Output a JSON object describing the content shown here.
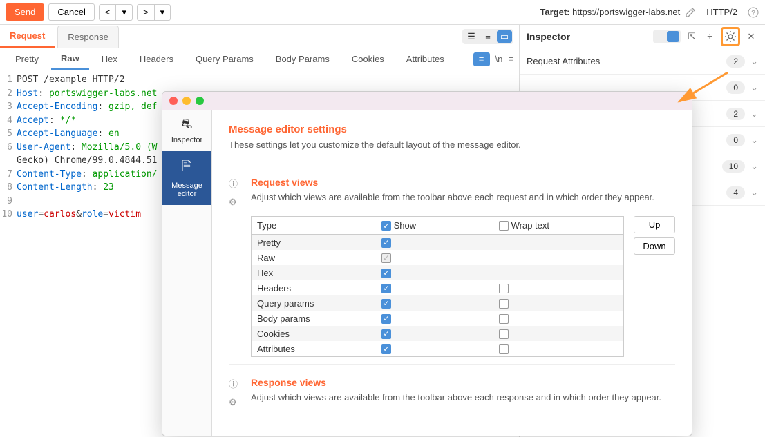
{
  "toolbar": {
    "send": "Send",
    "cancel": "Cancel",
    "prev": "<",
    "next": ">",
    "target_label": "Target:",
    "target_url": "https://portswigger-labs.net",
    "http_version": "HTTP/2"
  },
  "tabs": {
    "request": "Request",
    "response": "Response"
  },
  "subtabs": [
    "Pretty",
    "Raw",
    "Hex",
    "Headers",
    "Query Params",
    "Body Params",
    "Cookies",
    "Attributes"
  ],
  "subtab_active": 1,
  "request_lines": [
    {
      "n": "1",
      "raw": "POST /example HTTP/2"
    },
    {
      "n": "2",
      "h": "Host",
      "v": " portswigger-labs.net"
    },
    {
      "n": "3",
      "h": "Accept-Encoding",
      "v": " gzip, def"
    },
    {
      "n": "4",
      "h": "Accept",
      "v": " */*"
    },
    {
      "n": "5",
      "h": "Accept-Language",
      "v": " en"
    },
    {
      "n": "6",
      "h": "User-Agent",
      "v": " Mozilla/5.0 (W"
    },
    {
      "n": "",
      "raw": "Gecko) Chrome/99.0.4844.51"
    },
    {
      "n": "7",
      "h": "Content-Type",
      "v": " application/"
    },
    {
      "n": "8",
      "h": "Content-Length",
      "v": " 23"
    },
    {
      "n": "9",
      "raw": ""
    },
    {
      "n": "10",
      "body": [
        [
          "user",
          "carlos"
        ],
        [
          "role",
          "victim"
        ]
      ]
    }
  ],
  "inspector": {
    "title": "Inspector",
    "rows": [
      {
        "label": "Request Attributes",
        "count": "2"
      },
      {
        "label": "",
        "count": "0"
      },
      {
        "label": "",
        "count": "2"
      },
      {
        "label": "",
        "count": "0"
      },
      {
        "label": "",
        "count": "10"
      },
      {
        "label": "",
        "count": "4"
      }
    ]
  },
  "dialog": {
    "sidebar": [
      {
        "label": "Inspector",
        "icon": "car"
      },
      {
        "label": "Message editor",
        "icon": "doc"
      }
    ],
    "title": "Message editor settings",
    "subtitle": "These settings let you customize the default layout of the message editor.",
    "request_views": {
      "title": "Request views",
      "desc": "Adjust which views are available from the toolbar above each request and in which order they appear.",
      "cols": [
        "Type",
        "Show",
        "Wrap text"
      ],
      "rows": [
        {
          "type": "Pretty",
          "show": true,
          "wrap": null
        },
        {
          "type": "Raw",
          "show": "disabled",
          "wrap": null
        },
        {
          "type": "Hex",
          "show": true,
          "wrap": null
        },
        {
          "type": "Headers",
          "show": true,
          "wrap": false
        },
        {
          "type": "Query params",
          "show": true,
          "wrap": false
        },
        {
          "type": "Body params",
          "show": true,
          "wrap": false
        },
        {
          "type": "Cookies",
          "show": true,
          "wrap": false
        },
        {
          "type": "Attributes",
          "show": true,
          "wrap": false
        }
      ],
      "up": "Up",
      "down": "Down"
    },
    "response_views": {
      "title": "Response views",
      "desc": "Adjust which views are available from the toolbar above each response and in which order they appear."
    }
  }
}
